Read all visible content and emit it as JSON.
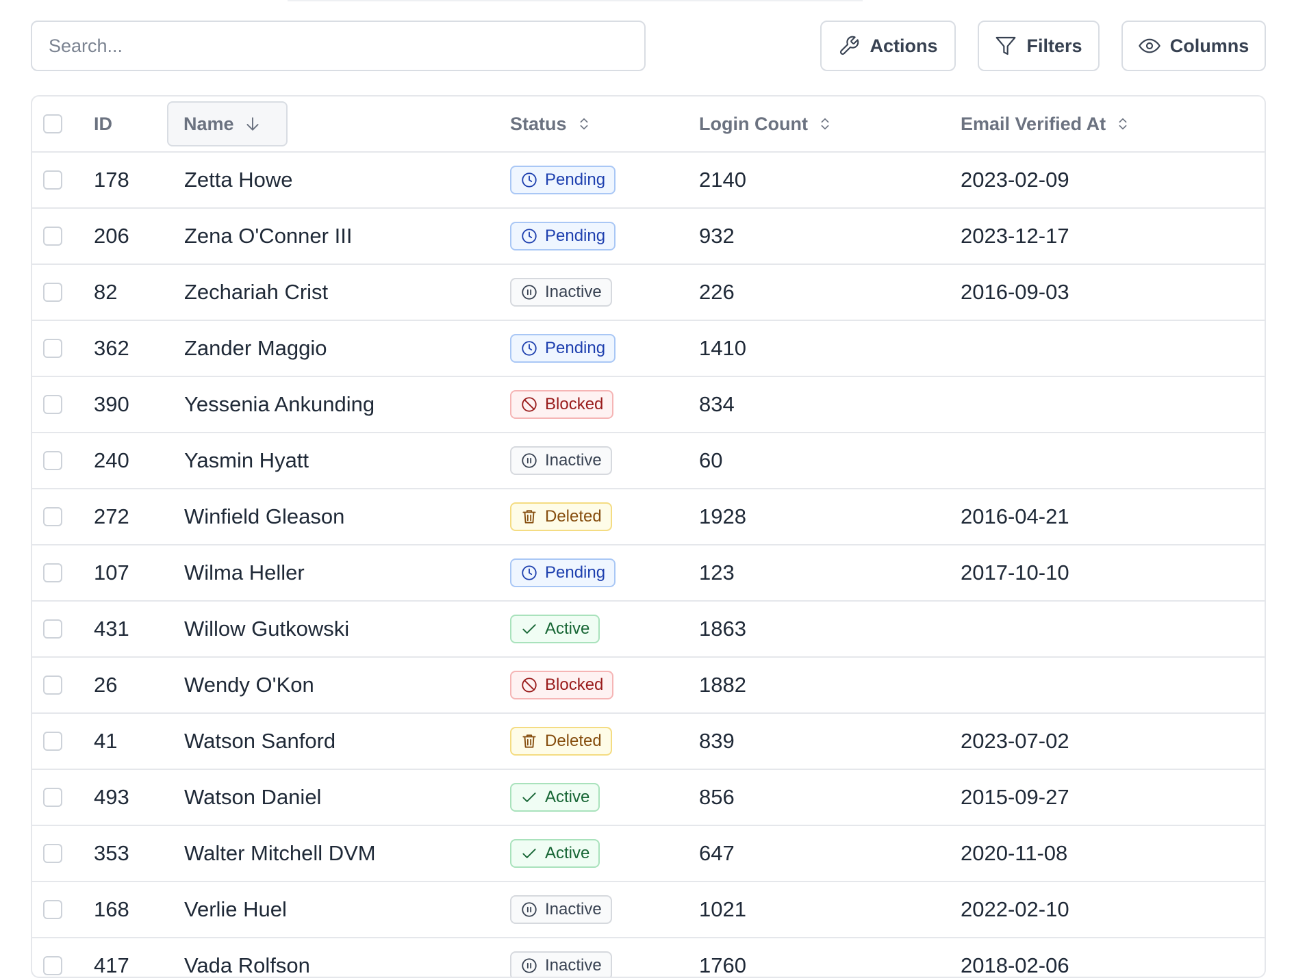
{
  "toolbar": {
    "search_placeholder": "Search...",
    "actions_label": "Actions",
    "filters_label": "Filters",
    "columns_label": "Columns"
  },
  "table": {
    "headers": {
      "id": "ID",
      "name": "Name",
      "status": "Status",
      "login_count": "Login Count",
      "email_verified_at": "Email Verified At"
    },
    "sort": {
      "column": "name",
      "direction": "descending"
    },
    "rows": [
      {
        "id": "178",
        "name": "Zetta Howe",
        "status": "Pending",
        "login_count": "2140",
        "email_verified_at": "2023-02-09"
      },
      {
        "id": "206",
        "name": "Zena O'Conner III",
        "status": "Pending",
        "login_count": "932",
        "email_verified_at": "2023-12-17"
      },
      {
        "id": "82",
        "name": "Zechariah Crist",
        "status": "Inactive",
        "login_count": "226",
        "email_verified_at": "2016-09-03"
      },
      {
        "id": "362",
        "name": "Zander Maggio",
        "status": "Pending",
        "login_count": "1410",
        "email_verified_at": ""
      },
      {
        "id": "390",
        "name": "Yessenia Ankunding",
        "status": "Blocked",
        "login_count": "834",
        "email_verified_at": ""
      },
      {
        "id": "240",
        "name": "Yasmin Hyatt",
        "status": "Inactive",
        "login_count": "60",
        "email_verified_at": ""
      },
      {
        "id": "272",
        "name": "Winfield Gleason",
        "status": "Deleted",
        "login_count": "1928",
        "email_verified_at": "2016-04-21"
      },
      {
        "id": "107",
        "name": "Wilma Heller",
        "status": "Pending",
        "login_count": "123",
        "email_verified_at": "2017-10-10"
      },
      {
        "id": "431",
        "name": "Willow Gutkowski",
        "status": "Active",
        "login_count": "1863",
        "email_verified_at": ""
      },
      {
        "id": "26",
        "name": "Wendy O'Kon",
        "status": "Blocked",
        "login_count": "1882",
        "email_verified_at": ""
      },
      {
        "id": "41",
        "name": "Watson Sanford",
        "status": "Deleted",
        "login_count": "839",
        "email_verified_at": "2023-07-02"
      },
      {
        "id": "493",
        "name": "Watson Daniel",
        "status": "Active",
        "login_count": "856",
        "email_verified_at": "2015-09-27"
      },
      {
        "id": "353",
        "name": "Walter Mitchell DVM",
        "status": "Active",
        "login_count": "647",
        "email_verified_at": "2020-11-08"
      },
      {
        "id": "168",
        "name": "Verlie Huel",
        "status": "Inactive",
        "login_count": "1021",
        "email_verified_at": "2022-02-10"
      },
      {
        "id": "417",
        "name": "Vada Rolfson",
        "status": "Inactive",
        "login_count": "1760",
        "email_verified_at": "2018-02-06"
      }
    ]
  },
  "status_styles": {
    "Pending": {
      "icon": "clock-icon",
      "color": "#1e40af",
      "background": "#eff6ff"
    },
    "Inactive": {
      "icon": "pause-circle-icon",
      "color": "#374151",
      "background": "#f9fafb"
    },
    "Blocked": {
      "icon": "ban-icon",
      "color": "#991b1b",
      "background": "#fef2f2"
    },
    "Deleted": {
      "icon": "trash-icon",
      "color": "#854d0e",
      "background": "#fefce8"
    },
    "Active": {
      "icon": "check-icon",
      "color": "#166534",
      "background": "#f0fdf4"
    }
  }
}
